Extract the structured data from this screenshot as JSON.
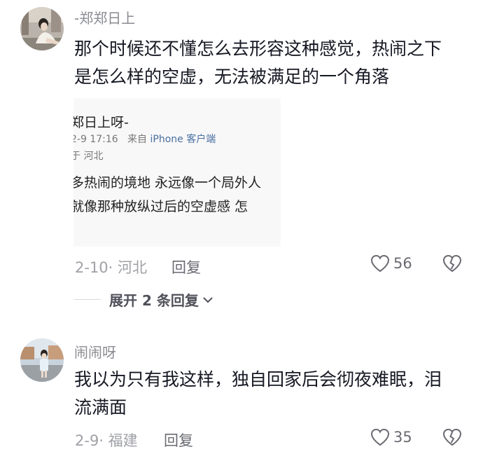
{
  "comments": [
    {
      "username": "-郑郑日上",
      "text_lines": [
        "那个时候还不懂怎么去形容这种感觉，热闹之下",
        "是怎么样的空虚，无法被满足的一个角落"
      ],
      "date_location": "2-10· 河北",
      "reply_label": "回复",
      "likes": "56",
      "expand_label": "展开 2 条回复",
      "quoted_screenshot": {
        "name": "郑日上呀-",
        "time": "2-9 17:16",
        "source": "来自",
        "device": "iPhone 客户端",
        "location": "于 河北",
        "line1": "多热闹的境地 永远像一个局外人",
        "line2": "就像那种放纵过后的空虚感 怎"
      }
    },
    {
      "username": "闹闹呀",
      "text_lines": [
        "我以为只有我这样，独自回家后会彻夜难眠，泪",
        "流满面"
      ],
      "date_location": "2-9· 福建",
      "reply_label": "回复",
      "likes": "35"
    }
  ],
  "icons": {
    "like": "heart-outline-icon",
    "dislike": "broken-heart-icon",
    "expand": "chevron-down-icon"
  }
}
